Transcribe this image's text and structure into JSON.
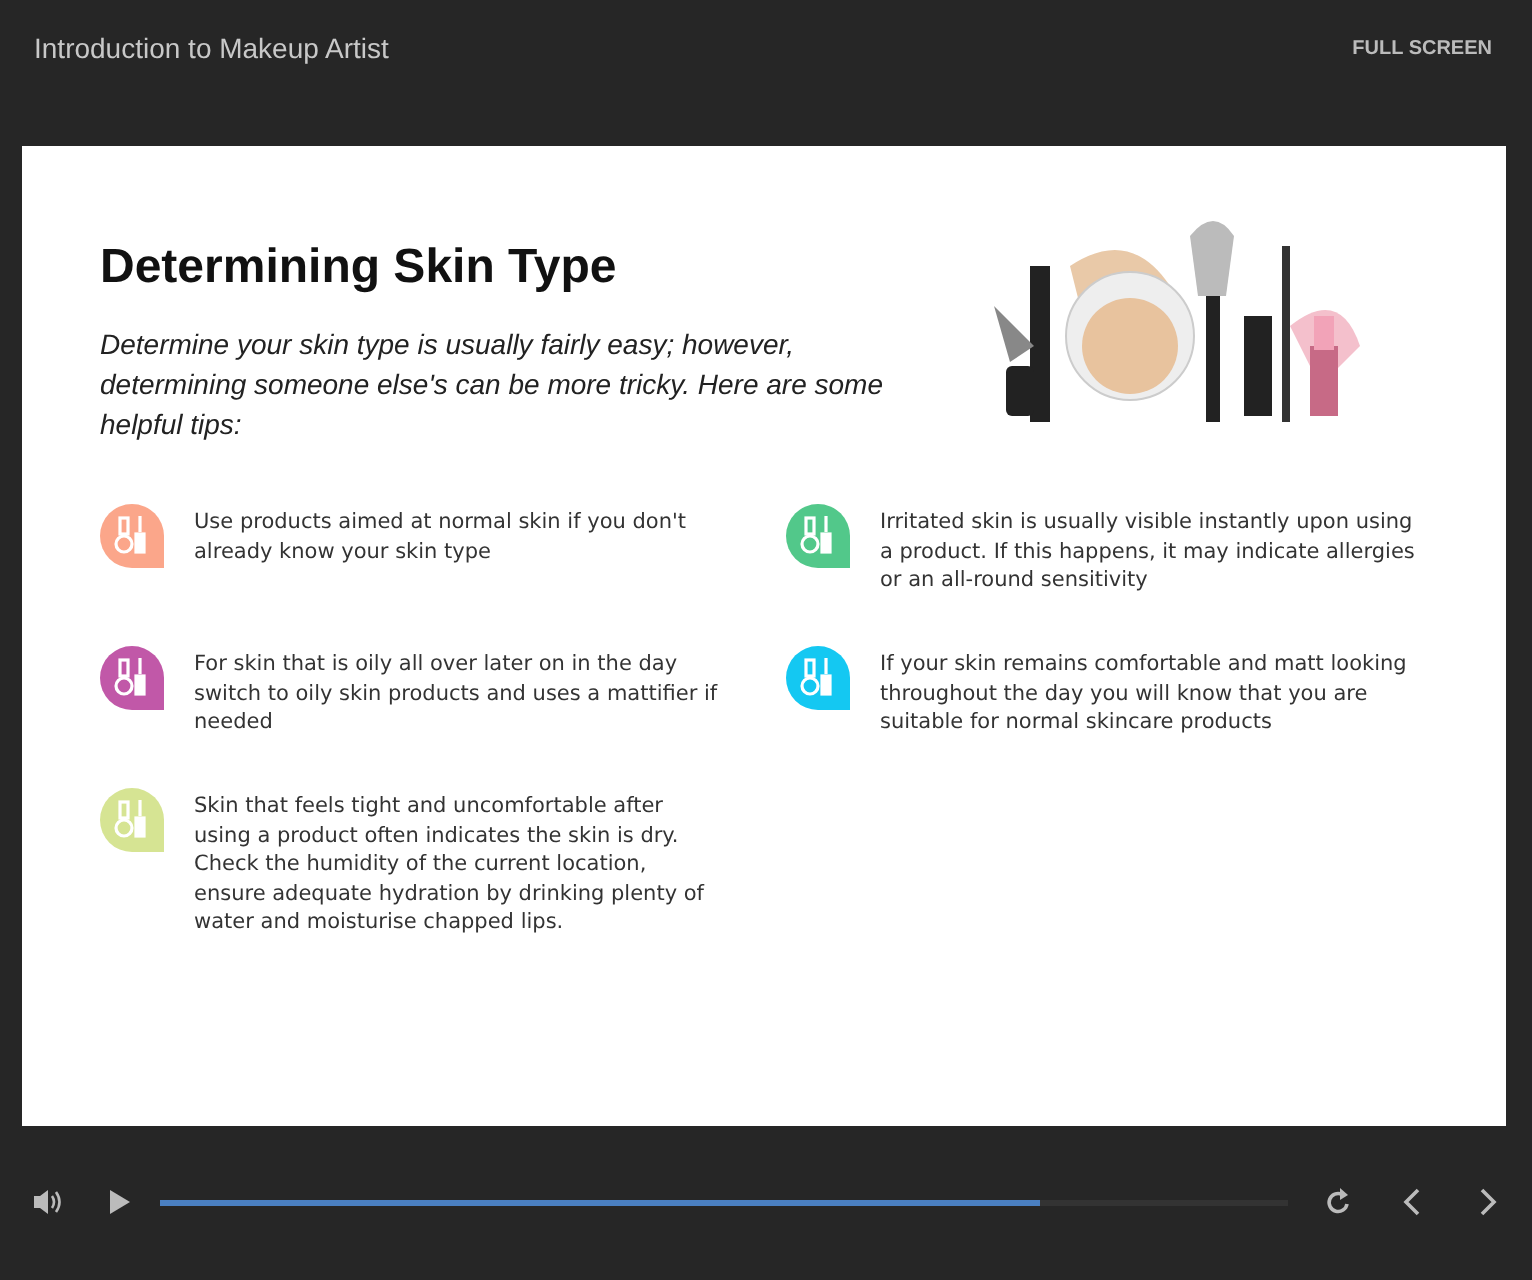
{
  "header": {
    "title": "Introduction to Makeup Artist",
    "fullscreen": "FULL SCREEN"
  },
  "slide": {
    "title": "Determining Skin Type",
    "intro": "Determine your skin type is usually fairly easy; however, determining someone else's can be more tricky. Here are some helpful tips:",
    "tips_left": [
      {
        "text": "Use products aimed at normal skin if you don't already know your skin type",
        "color": "#fba68a"
      },
      {
        "text": "For skin that is oily all over later on in the day switch to oily skin products and uses a mattifier if needed",
        "color": "#c158a8"
      },
      {
        "text": "Skin that feels tight and uncomfortable after using a product often indicates the skin is dry. Check the humidity of the current location, ensure adequate hydration by drinking plenty of water and moisturise chapped lips.",
        "color": "#d6e493"
      }
    ],
    "tips_right": [
      {
        "text": "Irritated skin is usually visible instantly upon using a product.  If this happens, it may indicate allergies or an all-round sensitivity",
        "color": "#52c88a"
      },
      {
        "text": "If your skin remains comfortable and matt looking throughout the day you will know that you are suitable for normal skincare products",
        "color": "#14c8f2"
      }
    ]
  },
  "player": {
    "level": 0.78
  }
}
